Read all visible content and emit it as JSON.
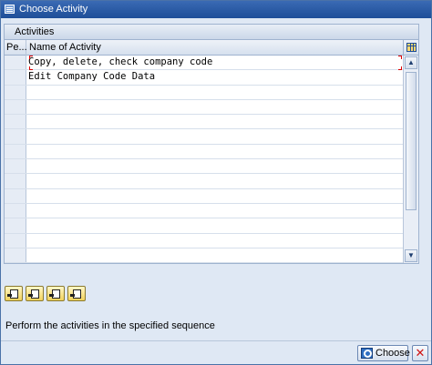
{
  "window": {
    "title": "Choose Activity",
    "icon": "window-icon"
  },
  "tab": {
    "label": "Activities"
  },
  "table": {
    "columns": {
      "pe": "Pe...",
      "name": "Name of Activity"
    },
    "rows": [
      {
        "name": "Copy, delete, check company code"
      },
      {
        "name": "Edit Company Code Data"
      }
    ],
    "config_icon": "table-settings-icon"
  },
  "toolbar": {
    "buttons": [
      "first-activity-icon",
      "next-activity-icon",
      "previous-activity-icon",
      "last-activity-icon"
    ]
  },
  "hint": "Perform the activities in the specified sequence",
  "footer": {
    "choose_label": "Choose",
    "cancel_icon": "close-icon"
  }
}
